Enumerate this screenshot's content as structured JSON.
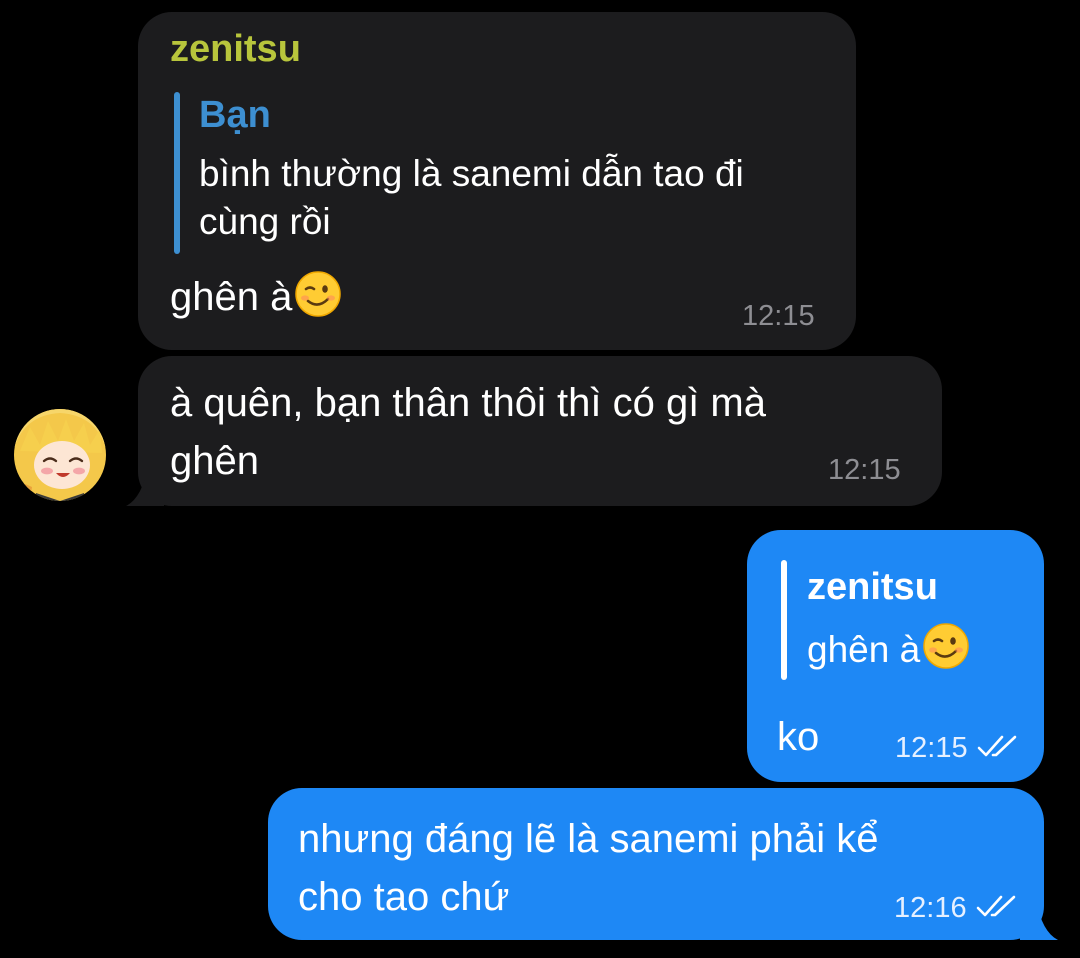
{
  "messages": [
    {
      "sender": "zenitsu",
      "reply": {
        "author": "Bạn",
        "text_line1": "bình thường là sanemi dẫn tao đi",
        "text_line2": "cùng rồi"
      },
      "text": "ghên à",
      "emoji": "winking-face-emoji",
      "time": "12:15"
    },
    {
      "text_line1": "à quên, bạn thân thôi thì có gì mà",
      "text_line2": "ghên",
      "time": "12:15"
    },
    {
      "reply": {
        "author": "zenitsu",
        "text": "ghên à",
        "emoji": "winking-face-emoji"
      },
      "text": "ko",
      "time": "12:15",
      "read": true
    },
    {
      "text_line1": "nhưng đáng lẽ là sanemi phải kể",
      "text_line2": "cho tao chứ",
      "time": "12:16",
      "read": true
    }
  ],
  "colors": {
    "background": "#000000",
    "incoming_bubble": "#1c1c1e",
    "outgoing_bubble": "#1e88f5",
    "sender_name": "#b8c53c",
    "incoming_quote_accent": "#3d8fd1",
    "outgoing_quote_accent": "#ffffff"
  }
}
